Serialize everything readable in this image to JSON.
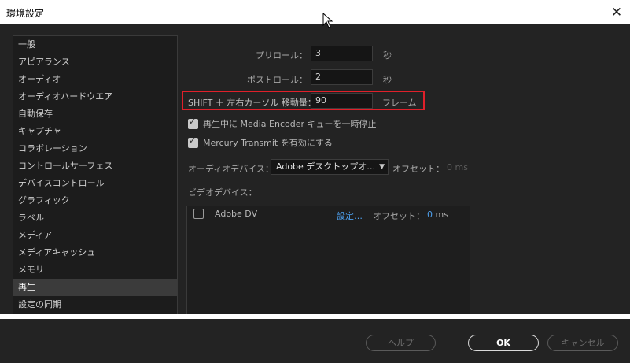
{
  "window": {
    "title": "環境設定"
  },
  "sidebar": {
    "items": [
      {
        "label": "一般"
      },
      {
        "label": "アピアランス"
      },
      {
        "label": "オーディオ"
      },
      {
        "label": "オーディオハードウエア"
      },
      {
        "label": "自動保存"
      },
      {
        "label": "キャプチャ"
      },
      {
        "label": "コラボレーション"
      },
      {
        "label": "コントロールサーフェス"
      },
      {
        "label": "デバイスコントロール"
      },
      {
        "label": "グラフィック"
      },
      {
        "label": "ラベル"
      },
      {
        "label": "メディア"
      },
      {
        "label": "メディアキャッシュ"
      },
      {
        "label": "メモリ"
      },
      {
        "label": "再生"
      },
      {
        "label": "設定の同期"
      }
    ],
    "active": "再生"
  },
  "playback": {
    "preroll": {
      "label": "プリロール：",
      "value": "3",
      "unit": "秒"
    },
    "postroll": {
      "label": "ポストロール：",
      "value": "2",
      "unit": "秒"
    },
    "shift_cursor": {
      "label": "SHIFT ＋ 左右カーソル 移動量：",
      "value": "90",
      "unit": "フレーム"
    },
    "pause_encoder": {
      "label": "再生中に Media Encoder キューを一時停止",
      "checked": true
    },
    "mercury_transmit": {
      "label": "Mercury Transmit を有効にする",
      "checked": true
    }
  },
  "audio_device": {
    "label": "オーディオデバイス：",
    "selected": "Adobe デスクトップオ…",
    "offset_label": "オフセット：",
    "offset_value": "0 ms"
  },
  "video_device": {
    "label": "ビデオデバイス：",
    "devices": [
      {
        "name": "Adobe DV",
        "checked": false,
        "settings_link": "設定…",
        "offset_label": "オフセット：",
        "offset_value": "0",
        "offset_unit": "ms"
      }
    ]
  },
  "footer": {
    "help_label": "ヘルプ",
    "ok_label": "OK",
    "cancel_label": "キャンセル"
  },
  "colors": {
    "highlight": "#e0202a",
    "link": "#4da0ef",
    "background": "#232323"
  },
  "icons": [
    "close-icon",
    "cursor-icon",
    "checkmark-icon",
    "chevron-down-icon"
  ]
}
